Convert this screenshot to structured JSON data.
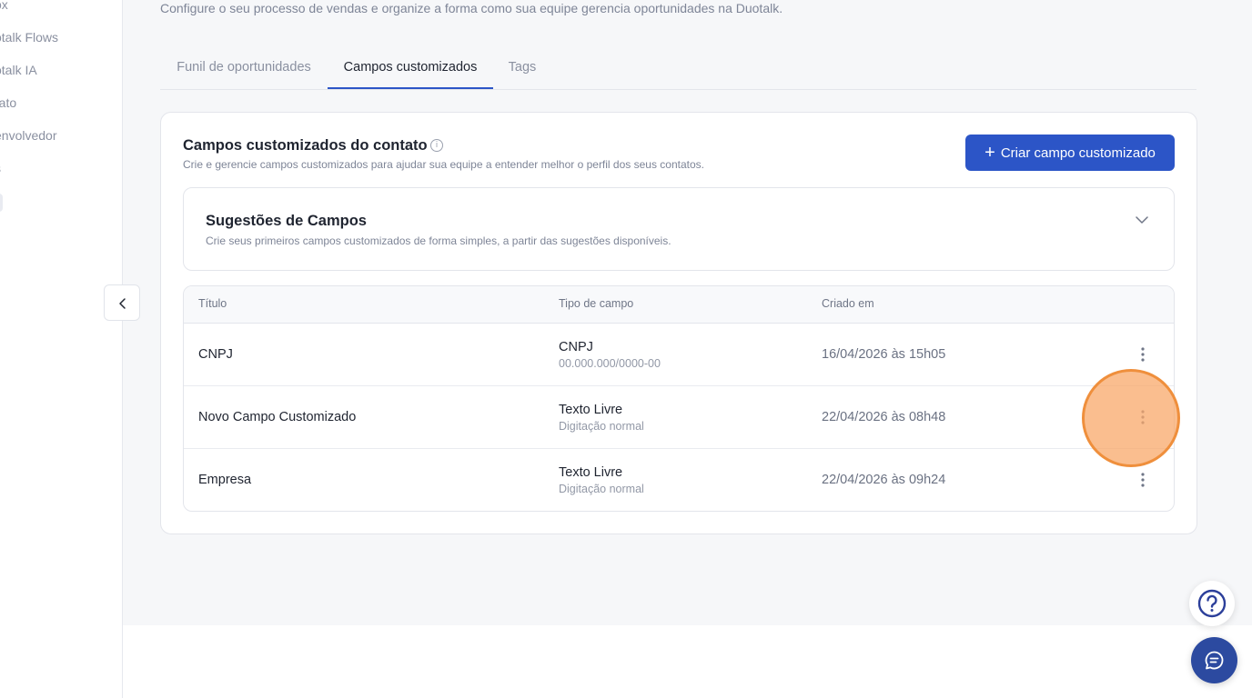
{
  "sidebar": {
    "items": [
      {
        "label": "ox"
      },
      {
        "label": "otalk Flows"
      },
      {
        "label": "otalk IA"
      },
      {
        "label": "rato"
      },
      {
        "label": "envolvedor"
      },
      {
        "label": "s"
      }
    ]
  },
  "page": {
    "subtitle": "Configure o seu processo de vendas e organize a forma como sua equipe gerencia oportunidades na Duotalk."
  },
  "tabs": [
    {
      "label": "Funil de oportunidades",
      "active": false
    },
    {
      "label": "Campos customizados",
      "active": true
    },
    {
      "label": "Tags",
      "active": false
    }
  ],
  "card": {
    "title": "Campos customizados do contato",
    "info_icon": "i",
    "description": "Crie e gerencie campos customizados para ajudar sua equipe a entender melhor o perfil dos seus contatos.",
    "create_button": {
      "icon": "+",
      "label": "Criar campo customizado"
    }
  },
  "suggestions": {
    "title": "Sugestões de Campos",
    "description": "Crie seus primeiros campos customizados de forma simples, a partir das sugestões disponíveis."
  },
  "table": {
    "headers": {
      "title": "Título",
      "type": "Tipo de campo",
      "created": "Criado em"
    },
    "rows": [
      {
        "title": "CNPJ",
        "type": "CNPJ",
        "type_sub": "00.000.000/0000-00",
        "created": "16/04/2026 às 15h05"
      },
      {
        "title": "Novo Campo Customizado",
        "type": "Texto Livre",
        "type_sub": "Digitação normal",
        "created": "22/04/2026 às 08h48"
      },
      {
        "title": "Empresa",
        "type": "Texto Livre",
        "type_sub": "Digitação normal",
        "created": "22/04/2026 às 09h24"
      }
    ]
  },
  "colors": {
    "accent": "#2c55c7",
    "chat_button": "#2c4aa0",
    "highlight": "#f8a869"
  },
  "icons": {
    "help": "question-circle-icon",
    "chat": "chat-bubble-icon",
    "collapse": "chevron-left-icon",
    "expand": "chevron-down-icon",
    "row_menu": "kebab-menu-icon"
  }
}
